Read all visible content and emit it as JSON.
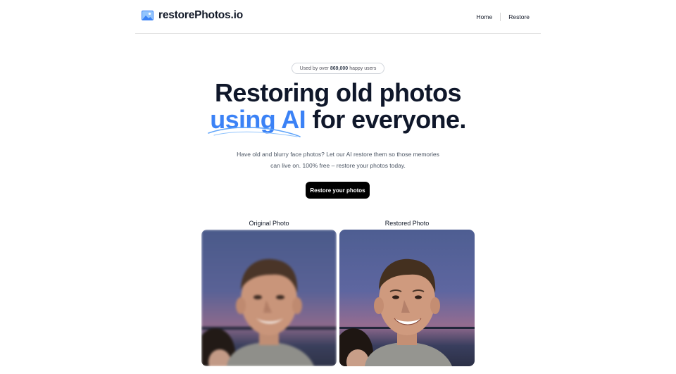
{
  "header": {
    "brand": "restorePhotos.io",
    "logo_icon": "image-icon",
    "nav": [
      {
        "label": "Home"
      },
      {
        "label": "Restore"
      }
    ]
  },
  "badge": {
    "prefix": "Used by over",
    "count": "869,000",
    "suffix": "happy users"
  },
  "hero": {
    "title_line1": "Restoring old photos",
    "title_accent": "using AI",
    "title_rest": "for everyone.",
    "accent_color": "#3b82f6",
    "subtitle": "Have old and blurry face photos? Let our AI restore them so those memories can live on. 100% free – restore your photos today.",
    "cta_label": "Restore your photos"
  },
  "comparison": {
    "original_label": "Original Photo",
    "restored_label": "Restored Photo"
  }
}
